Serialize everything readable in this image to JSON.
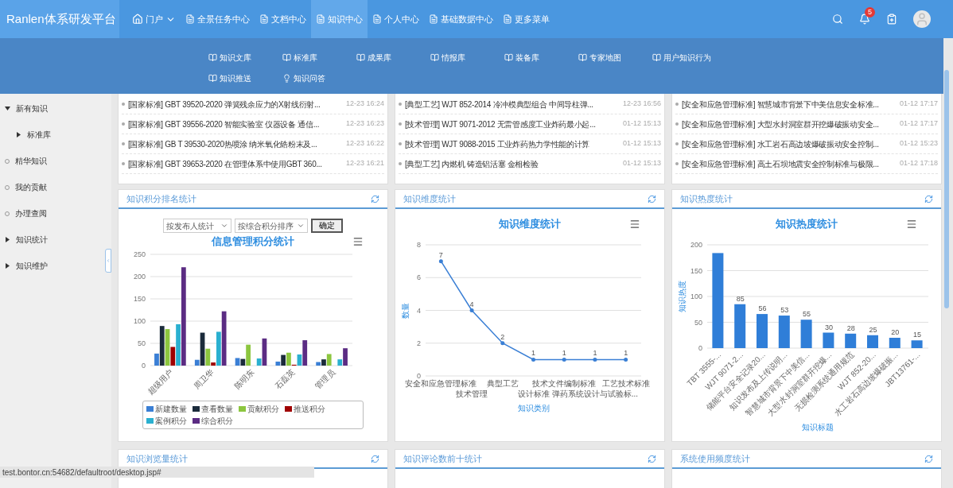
{
  "header": {
    "brand": "Ranlen体系研发平台",
    "nav": [
      {
        "label": "门户",
        "kind": "dropdown",
        "selected": false
      },
      {
        "label": "全景任务中心",
        "kind": "link",
        "selected": false
      },
      {
        "label": "文档中心",
        "kind": "link",
        "selected": false
      },
      {
        "label": "知识中心",
        "kind": "link",
        "selected": true
      },
      {
        "label": "个人中心",
        "kind": "link",
        "selected": false
      },
      {
        "label": "基础数据中心",
        "kind": "link",
        "selected": false
      },
      {
        "label": "更多菜单",
        "kind": "link",
        "selected": false
      }
    ],
    "notification_count": "5"
  },
  "submenu": [
    {
      "label": "知识文库",
      "kind": "library"
    },
    {
      "label": "标准库",
      "kind": "library"
    },
    {
      "label": "成果库",
      "kind": "library"
    },
    {
      "label": "情报库",
      "kind": "library"
    },
    {
      "label": "装备库",
      "kind": "library"
    },
    {
      "label": "专家地图",
      "kind": "library"
    },
    {
      "label": "用户知识行为",
      "kind": "library"
    },
    {
      "label": "知识推送",
      "kind": "library"
    },
    {
      "label": "知识问答",
      "kind": "faq"
    }
  ],
  "sidebar": {
    "items": [
      {
        "label": "新有知识",
        "kind": "group",
        "expanded": true,
        "children": [
          {
            "label": "标准库",
            "kind": "group",
            "expanded": false
          }
        ]
      },
      {
        "label": "精华知识",
        "kind": "leaf"
      },
      {
        "label": "我的贡献",
        "kind": "leaf"
      },
      {
        "label": "办理查阅",
        "kind": "leaf"
      },
      {
        "label": "知识统计",
        "kind": "group",
        "expanded": false
      },
      {
        "label": "知识维护",
        "kind": "group",
        "expanded": false
      }
    ]
  },
  "lists": [
    {
      "rows": [
        {
          "text": "[国家标准] GBT 39520-2020 弹簧残余应力的X射线衍射...",
          "time": "12-23 16:24"
        },
        {
          "text": "[国家标准] GBT 39556-2020 智能实验室 仪器设备 通信...",
          "time": "12-23 16:23"
        },
        {
          "text": "[国家标准] GB T 39530-2020热喷涂 纳米氧化锆粉末及...",
          "time": "12-23 16:22"
        },
        {
          "text": "[国家标准] GBT 39653-2020 在管理体系中使用GBT 360...",
          "time": "12-23 16:21"
        }
      ]
    },
    {
      "rows": [
        {
          "text": "[典型工艺] WJT 852-2014 冷冲模典型组合 中间导柱弹...",
          "time": "12-23 16:56"
        },
        {
          "text": "[技术管理] WJT 9071-2012 无雷管感度工业炸药最小起...",
          "time": "01-12 15:13"
        },
        {
          "text": "[技术管理] WJT 9088-2015 工业炸药热力学性能的计算",
          "time": "01-12 15:13"
        },
        {
          "text": "[典型工艺] 内燃机 铸造铝活塞 金相检验",
          "time": "01-12 15:13"
        }
      ]
    },
    {
      "rows": [
        {
          "text": "[安全和应急管理标准] 智慧城市背景下中美信息安全标准...",
          "time": "01-12 17:17"
        },
        {
          "text": "[安全和应急管理标准] 大型水封洞室群开挖爆破振动安全...",
          "time": "01-12 17:17"
        },
        {
          "text": "[安全和应急管理标准] 水工岩石高边坡爆破振动安全控制...",
          "time": "01-12 15:23"
        },
        {
          "text": "[安全和应急管理标准] 高土石坝地震安全控制标准与极限...",
          "time": "01-12 17:18"
        }
      ]
    }
  ],
  "score_panel": {
    "title": "知识积分排名统计",
    "group_select": "按发布人统计",
    "sort_select": "按综合积分排序",
    "confirm_button": "确定",
    "chart_data": {
      "type": "bar",
      "title": "信息管理积分统计",
      "categories": [
        "超级用户",
        "周卫华",
        "陈明东",
        "石磊英",
        "管理员"
      ],
      "yticks": [
        0,
        50,
        100,
        150,
        200,
        250
      ],
      "ylim": [
        0,
        250
      ],
      "grid": true,
      "series": [
        {
          "name": "新建数量",
          "color": "#3a7fd5",
          "values": [
            27,
            13,
            17,
            9,
            8
          ]
        },
        {
          "name": "查看数量",
          "color": "#1b2b3b",
          "values": [
            89,
            74,
            15,
            24,
            14
          ]
        },
        {
          "name": "贡献积分",
          "color": "#8cc63f",
          "values": [
            82,
            38,
            47,
            29,
            26
          ]
        },
        {
          "name": "推送积分",
          "color": "#a00000",
          "values": [
            42,
            7,
            0,
            2,
            0
          ]
        },
        {
          "name": "案例积分",
          "color": "#2ab0d0",
          "values": [
            93,
            76,
            16,
            25,
            14
          ]
        },
        {
          "name": "综合积分",
          "color": "#5b2c83",
          "values": [
            221,
            122,
            61,
            57,
            39
          ]
        }
      ]
    }
  },
  "dimension_panel": {
    "title": "知识维度统计",
    "chart_data": {
      "type": "line",
      "title": "知识维度统计",
      "xlabel": "知识类别",
      "categories": [
        "安全和应急管理标准",
        "技术管理",
        "典型工艺",
        "设计标准",
        "技术文件编制标准",
        "弹药系统设计与试验标...",
        "工艺技术标准"
      ],
      "yticks": [
        0,
        2,
        4,
        6,
        8
      ],
      "ylim": [
        0,
        8
      ],
      "grid": true,
      "data_labels": true,
      "series": [
        {
          "name": "数量",
          "color": "#3a7fd5",
          "values": [
            7,
            4,
            2,
            1,
            1,
            1,
            1
          ]
        }
      ]
    }
  },
  "heat_panel": {
    "title": "知识热度统计",
    "chart_data": {
      "type": "bar",
      "title": "知识热度统计",
      "xlabel": "知识标题",
      "categories": [
        "TBT 3555-...",
        "WJT 9071-2...",
        "储能平台安全记录20...",
        "知识发布及上传说明...",
        "智慧城市背景下中美信...",
        "大型水封洞室群开挖爆...",
        "无损检测系统通用规范",
        "WJT 852-20...",
        "水工岩石高边坡爆破振...",
        "JBT13761-..."
      ],
      "yticks": [
        0,
        50,
        100,
        150,
        200
      ],
      "ylim": [
        0,
        200
      ],
      "grid": true,
      "series": [
        {
          "name": "知识热度",
          "color": "#2f7ed8",
          "values": [
            184,
            85,
            66,
            63,
            55,
            30,
            28,
            25,
            20,
            15
          ]
        }
      ],
      "value_labels": [
        null,
        "85",
        "56",
        "53",
        "55",
        "30",
        "28",
        "25",
        "20",
        "15"
      ]
    }
  },
  "bottom_panels": [
    {
      "title": "知识浏览量统计"
    },
    {
      "title": "知识评论数前十统计"
    },
    {
      "title": "系统使用频度统计"
    }
  ],
  "status_url": "test.bontor.cn:54682/defaultroot/desktop.jsp#"
}
